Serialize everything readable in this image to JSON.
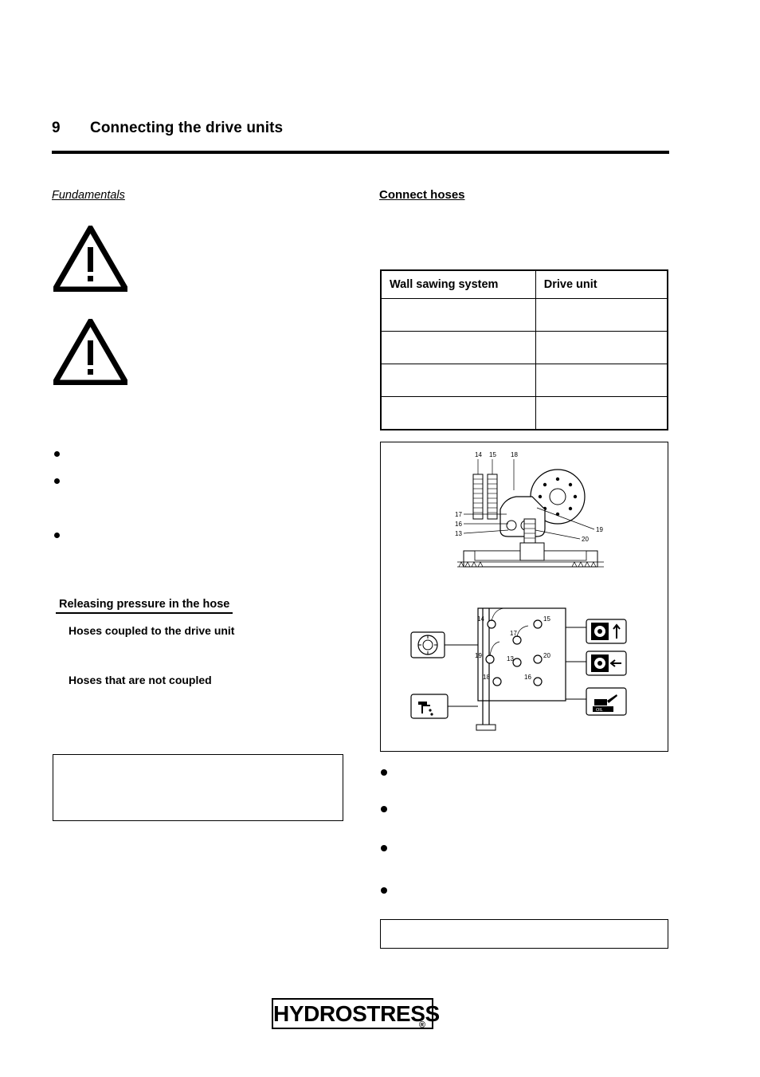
{
  "header": {
    "chapter_number": "9",
    "chapter_title": "Connecting the drive units"
  },
  "left_column": {
    "fundamentals_label": "Fundamentals",
    "releasing_pressure_heading": "Releasing pressure in the hose",
    "hoses_coupled_label": "Hoses coupled to the drive unit",
    "hoses_not_coupled_label": "Hoses that are not coupled"
  },
  "right_column": {
    "connect_hoses_label": "Connect hoses"
  },
  "table": {
    "headers": [
      "Wall sawing system",
      "Drive unit"
    ],
    "rows": [
      [
        "",
        ""
      ],
      [
        "",
        ""
      ],
      [
        "",
        ""
      ],
      [
        "",
        ""
      ]
    ]
  },
  "figure": {
    "top_callouts": [
      "14",
      "15",
      "18"
    ],
    "mid_left_callouts": [
      "17",
      "16",
      "13"
    ],
    "mid_right_callouts": [
      "19",
      "20"
    ],
    "panel_callouts": [
      "14",
      "15",
      "17",
      "19",
      "13",
      "20",
      "18",
      "16"
    ],
    "oil_label": "OIL"
  },
  "footer": {
    "logo_text": "HYDROSTRESS",
    "registered_mark": "®"
  }
}
